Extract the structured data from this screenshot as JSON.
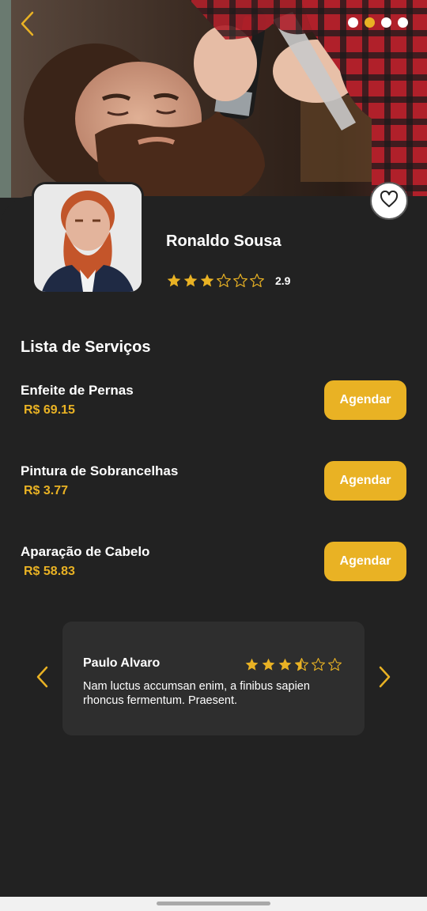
{
  "barber": {
    "name": "Ronaldo Sousa",
    "rating": 2.9,
    "rating_label": "2.9"
  },
  "gallery": {
    "photo_count": 4,
    "active_index": 1
  },
  "services_title": "Lista de Serviços",
  "services": [
    {
      "name": "Enfeite de Pernas",
      "price": "R$ 69.15",
      "button": "Agendar"
    },
    {
      "name": "Pintura de Sobrancelhas",
      "price": "R$ 3.77",
      "button": "Agendar"
    },
    {
      "name": "Aparação de Cabelo",
      "price": "R$ 58.83",
      "button": "Agendar"
    }
  ],
  "review": {
    "author": "Paulo Alvaro",
    "rating": 3.5,
    "text": "Nam luctus accumsan enim, a finibus sapien rhoncus fermentum. Praesent."
  },
  "colors": {
    "accent": "#e9b224",
    "background": "#222222",
    "card": "#2e2e2e"
  },
  "icons": {
    "back": "chevron-left-icon",
    "favorite": "heart-icon",
    "review_prev": "chevron-left-icon",
    "review_next": "chevron-right-icon",
    "star": "star-icon"
  }
}
